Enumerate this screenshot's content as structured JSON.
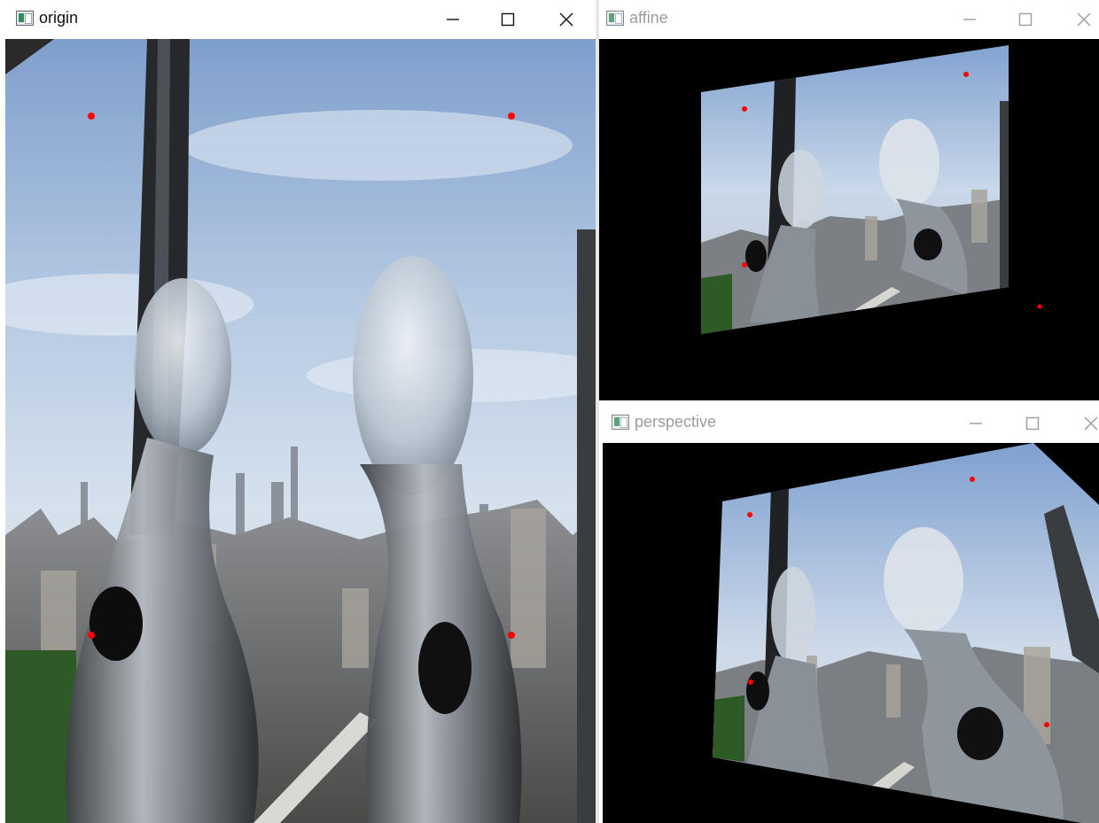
{
  "windows": {
    "origin": {
      "title": "origin"
    },
    "affine": {
      "title": "affine"
    },
    "perspective": {
      "title": "perspective"
    }
  },
  "icons": {
    "app": "opencv-window-icon",
    "minimize": "minimize-icon",
    "maximize": "maximize-icon",
    "close": "close-icon"
  },
  "colors": {
    "marker": "#ff0000",
    "sky": "#b9cde4",
    "background": "#000000",
    "title_active": "#111111",
    "title_inactive": "#9b9b9b"
  }
}
